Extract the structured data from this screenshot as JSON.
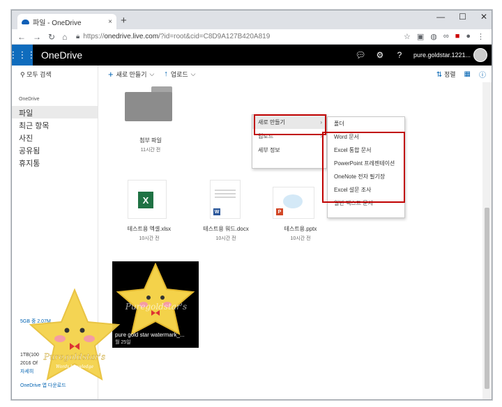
{
  "browser": {
    "tab_title": "파일 - OneDrive",
    "tab_close": "×",
    "new_tab": "+",
    "url_scheme": "https://",
    "url_host": "onedrive.live.com",
    "url_path": "/?id=root&cid=C8D9A127B420A819"
  },
  "header": {
    "app_name": "OneDrive",
    "user_name": "pure.goldstar.1221..."
  },
  "sidebar": {
    "search_label": "모두 검색",
    "section_title": "OneDrive",
    "items": [
      {
        "label": "파일",
        "active": true
      },
      {
        "label": "최근 항목"
      },
      {
        "label": "사진"
      },
      {
        "label": "공유됨"
      },
      {
        "label": "휴지통"
      }
    ],
    "quota": "5GB 중 2.07M",
    "premium_line1": "1TB(100",
    "premium_line2": "2016 Of",
    "premium_link": "자세히",
    "download_app": "OneDrive 앱 다운로드"
  },
  "commandbar": {
    "new_label": "새로 만들기",
    "upload_label": "업로드",
    "sort_label": "정렬"
  },
  "files": [
    {
      "name": "첨부 파일",
      "time": "11시간 전",
      "kind": "folder"
    },
    {
      "name": "테스트용 엑셀.xlsx",
      "time": "10시간 전",
      "kind": "excel"
    },
    {
      "name": "테스트용 워드.docx",
      "time": "10시간 전",
      "kind": "word"
    },
    {
      "name": "테스트용.pptx",
      "time": "10시간 전",
      "kind": "powerpoint"
    },
    {
      "name": "pure gold star watermark_...",
      "time": "월 25일",
      "kind": "image"
    }
  ],
  "context_menu": {
    "items": [
      "새로 만들기",
      "업로드",
      "세부 정보"
    ],
    "selected": "새로 만들기"
  },
  "submenu": {
    "items": [
      "폴더",
      "Word 문서",
      "Excel 통합 문서",
      "PowerPoint 프레젠테이션",
      "OneNote 전자 필기장",
      "Excel 설문 조사",
      "일반 텍스트 문서"
    ]
  },
  "watermark": {
    "text": "Puregoldstar's",
    "subtext": "Words knowledge"
  },
  "colors": {
    "accent": "#0f6cbd",
    "highlight_box": "#c00000",
    "header_bg": "#000000"
  }
}
